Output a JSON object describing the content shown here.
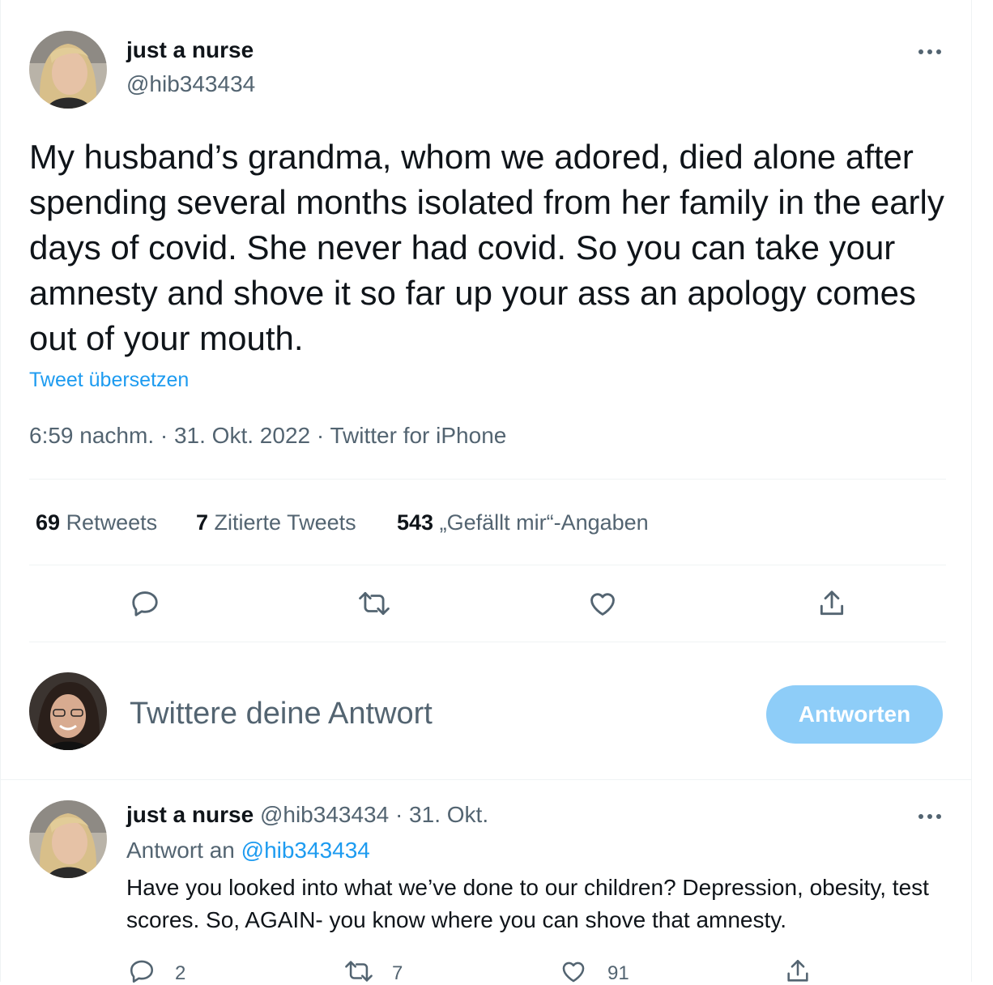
{
  "tweet": {
    "display_name": "just a nurse",
    "handle": "@hib343434",
    "more_icon": "more-horizontal-icon",
    "text": "My husband’s grandma, whom we adored, died alone after spending several months isolated from her family in the early days of covid. She never had covid. So you can take your amnesty and shove it so far up your ass an apology comes out of your mouth.",
    "translate_label": "Tweet übersetzen",
    "timestamp": "6:59 nachm. · 31. Okt. 2022 · Twitter for iPhone",
    "retweets_count": "69",
    "retweets_label": "Retweets",
    "quotes_count": "7",
    "quotes_label": "Zitierte Tweets",
    "likes_count": "543",
    "likes_label": "„Gefällt mir“-Angaben",
    "actions": [
      "reply-icon",
      "retweet-icon",
      "like-icon",
      "share-icon"
    ]
  },
  "compose": {
    "placeholder": "Twittere deine Antwort",
    "button_label": "Antworten",
    "button_color": "#8ecdf8"
  },
  "reply": {
    "display_name": "just a nurse",
    "handle_date": "@hib343434 · 31. Okt.",
    "replying_prefix": "Antwort an",
    "replying_to": "@hib343434",
    "text": "Have you looked into what we’ve done to our children? Depression, obesity, test scores. So, AGAIN- you know where you can shove that amnesty.",
    "reply_count": "2",
    "retweet_count": "7",
    "like_count": "91"
  },
  "colors": {
    "accent": "#1d9bf0",
    "secondary_text": "#536471",
    "divider": "#eff3f4"
  }
}
